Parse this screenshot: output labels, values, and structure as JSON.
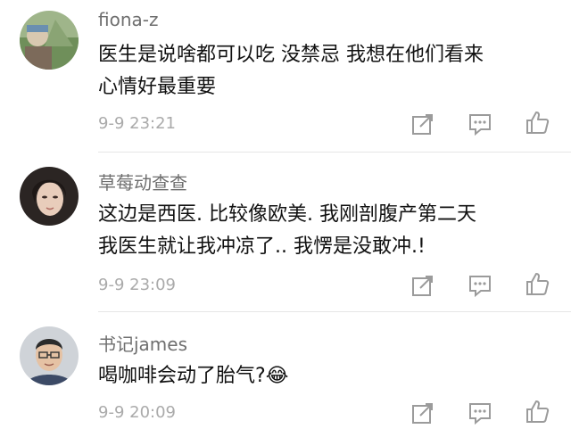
{
  "comments": [
    {
      "username": "fiona-z",
      "lines": [
        "医生是说啥都可以吃 没禁忌 我想在他们看来",
        "心情好最重要"
      ],
      "time": "9-9 23:21",
      "avatar": "avatar-landscape"
    },
    {
      "username": "草莓动查查",
      "lines": [
        "这边是西医. 比较像欧美. 我刚剖腹产第二天",
        "我医生就让我冲凉了.. 我愣是没敢冲.!"
      ],
      "time": "9-9 23:09",
      "avatar": "avatar-woman"
    },
    {
      "username": "书记james",
      "lines": [
        "喝咖啡会动了胎气?"
      ],
      "emoji": "😂",
      "time": "9-9 20:09",
      "avatar": "avatar-man"
    }
  ],
  "actions": {
    "share_icon": "share-icon",
    "comment_icon": "comment-icon",
    "like_icon": "thumbs-up-icon"
  },
  "colors": {
    "username": "#6f6f6f",
    "text": "#111111",
    "time": "#aaaaaa",
    "icon": "#9b9b9b",
    "divider": "#e6e6e6"
  }
}
